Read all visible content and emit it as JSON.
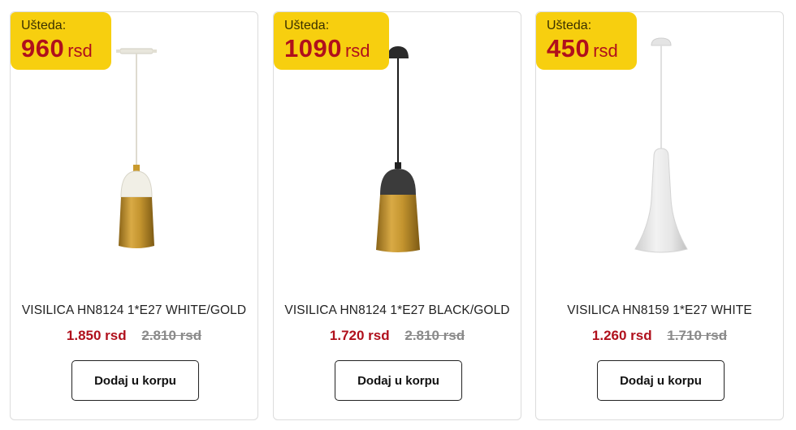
{
  "products": [
    {
      "savings_label": "Ušteda:",
      "savings_amount": "960",
      "savings_currency": "rsd",
      "name": "VISILICA HN8124 1*E27 WHITE/GOLD",
      "price_new": "1.850 rsd",
      "price_old": "2.810 rsd",
      "button_label": "Dodaj u korpu",
      "image_icon": "pendant-lamp-white-gold"
    },
    {
      "savings_label": "Ušteda:",
      "savings_amount": "1090",
      "savings_currency": "rsd",
      "name": "VISILICA HN8124 1*E27 BLACK/GOLD",
      "price_new": "1.720 rsd",
      "price_old": "2.810 rsd",
      "button_label": "Dodaj u korpu",
      "image_icon": "pendant-lamp-black-gold"
    },
    {
      "savings_label": "Ušteda:",
      "savings_amount": "450",
      "savings_currency": "rsd",
      "name": "VISILICA HN8159 1*E27 WHITE",
      "price_new": "1.260 rsd",
      "price_old": "1.710 rsd",
      "button_label": "Dodaj u korpu",
      "image_icon": "pendant-lamp-white-cone"
    }
  ],
  "colors": {
    "badge": "#f7cf0f",
    "price_accent": "#b0101c",
    "gold": "#c99a2e"
  }
}
